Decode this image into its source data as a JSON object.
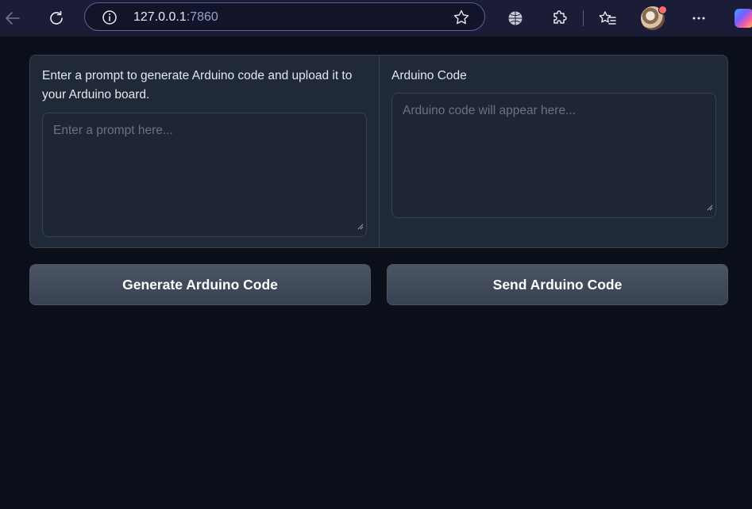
{
  "browser": {
    "url_host": "127.0.0.1",
    "url_port": ":7860"
  },
  "app": {
    "prompt_label": "Enter a prompt to generate Arduino code and upload it to your Arduino board.",
    "prompt_placeholder": "Enter a prompt here...",
    "code_label": "Arduino Code",
    "code_placeholder": "Arduino code will appear here...",
    "generate_button": "Generate Arduino Code",
    "send_button": "Send Arduino Code"
  },
  "colors": {
    "page_background": "#0b0f19",
    "panel_background": "#1f2937",
    "button_background": "#4b5563",
    "browser_toolbar": "#1a1d35"
  },
  "icons": [
    "back-arrow-icon",
    "reload-icon",
    "info-icon",
    "favorite-star-icon",
    "globe-icon",
    "extensions-puzzle-icon",
    "favorites-icon",
    "profile-avatar",
    "more-menu-icon",
    "copilot-icon",
    "resize-grip-icon"
  ]
}
